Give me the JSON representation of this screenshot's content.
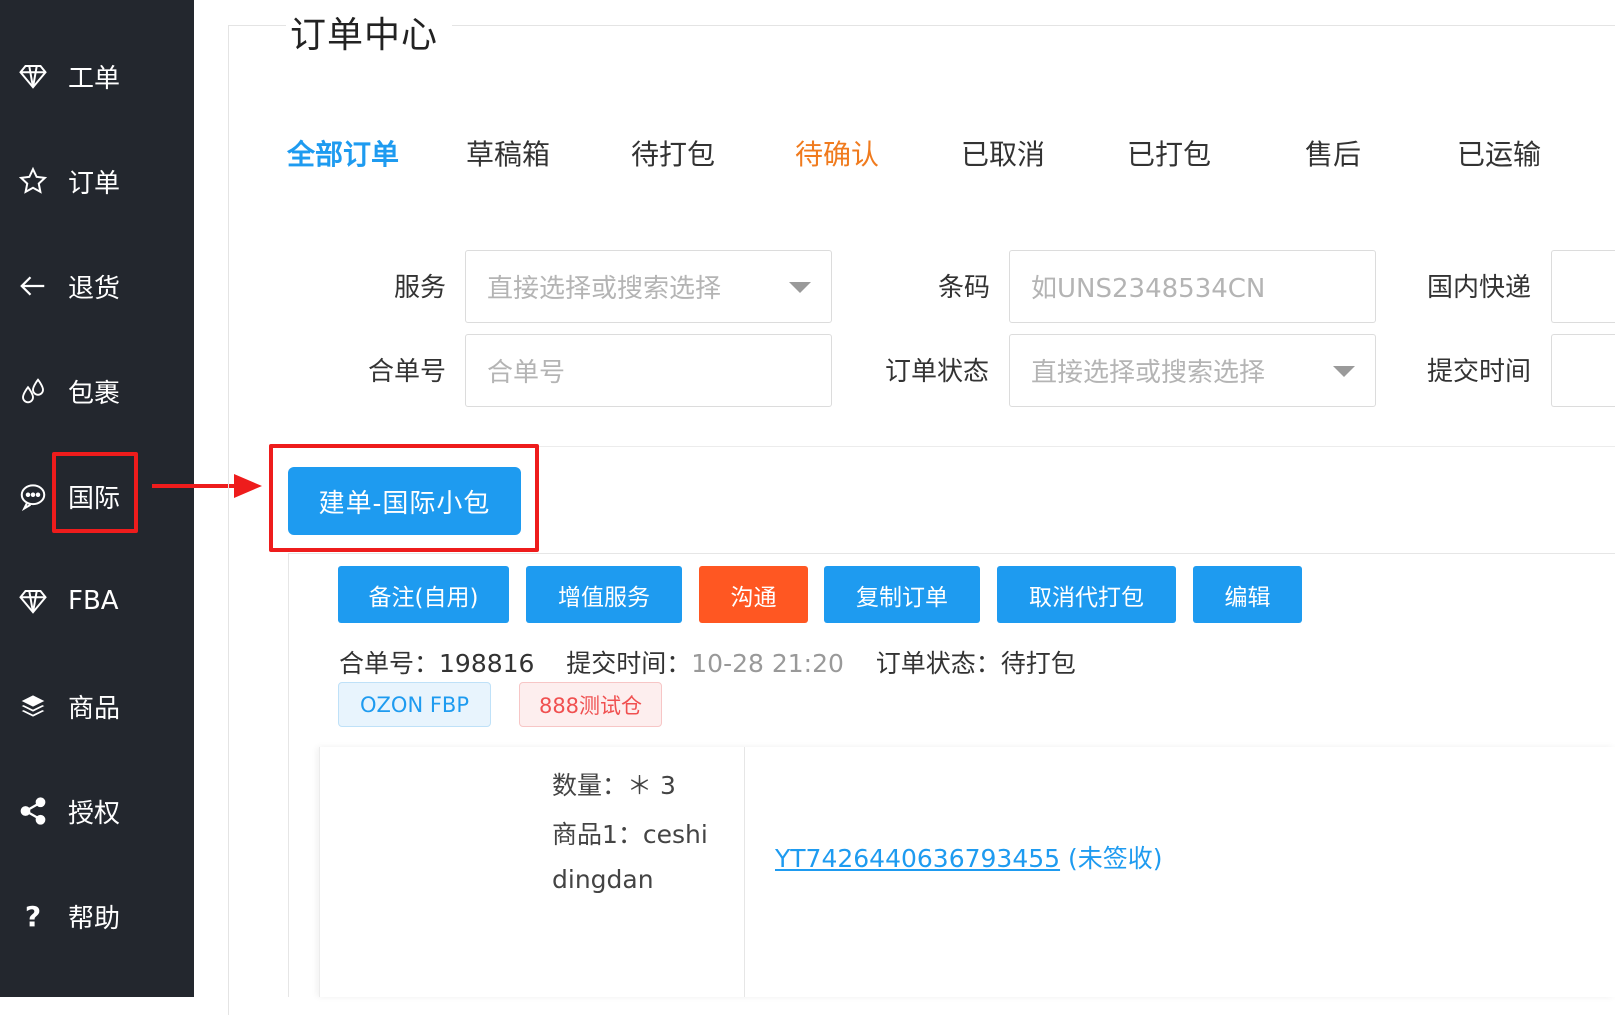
{
  "sidebar": {
    "items": [
      {
        "label": "工单",
        "icon": "diamond-icon"
      },
      {
        "label": "订单",
        "icon": "star-icon"
      },
      {
        "label": "退货",
        "icon": "arrow-left-icon"
      },
      {
        "label": "包裹",
        "icon": "drops-icon"
      },
      {
        "label": "国际",
        "icon": "chat-bubble-icon"
      },
      {
        "label": "FBA",
        "icon": "diamond-icon"
      },
      {
        "label": "商品",
        "icon": "layers-icon"
      },
      {
        "label": "授权",
        "icon": "share-icon"
      },
      {
        "label": "帮助",
        "icon": "question-icon"
      }
    ]
  },
  "page": {
    "title": "订单中心"
  },
  "tabs": [
    {
      "label": "全部订单",
      "state": "active"
    },
    {
      "label": "草稿箱"
    },
    {
      "label": "待打包"
    },
    {
      "label": "待确认",
      "state": "warn"
    },
    {
      "label": "已取消"
    },
    {
      "label": "已打包"
    },
    {
      "label": "售后"
    },
    {
      "label": "已运输"
    }
  ],
  "filters": {
    "service": {
      "label": "服务",
      "placeholder": "直接选择或搜索选择"
    },
    "barcode": {
      "label": "条码",
      "placeholder": "如UNS2348534CN"
    },
    "domestic_express": {
      "label": "国内快递"
    },
    "merge_no": {
      "label": "合单号",
      "placeholder": "合单号"
    },
    "order_status": {
      "label": "订单状态",
      "placeholder": "直接选择或搜索选择"
    },
    "submit_time": {
      "label": "提交时间"
    }
  },
  "create_button": {
    "label": "建单-国际小包"
  },
  "actions": [
    {
      "label": "备注(自用)",
      "color": "#1e9bf0"
    },
    {
      "label": "增值服务",
      "color": "#1e9bf0"
    },
    {
      "label": "沟通",
      "color": "#ff5722"
    },
    {
      "label": "复制订单",
      "color": "#1e9bf0"
    },
    {
      "label": "取消代打包",
      "color": "#1e9bf0"
    },
    {
      "label": "编辑",
      "color": "#1e9bf0"
    }
  ],
  "order": {
    "merge_label": "合单号：",
    "merge_no": "198816",
    "submit_label": "提交时间：",
    "submit_time": "10-28 21:20",
    "status_label": "订单状态：",
    "status": "待打包",
    "tags": [
      "OZON FBP",
      "888测试仓"
    ],
    "quantity": "数量：＊ 3",
    "product_line1": "商品1：ceshi",
    "product_line2": "dingdan",
    "tracking_no": "YT7426440636793455",
    "tracking_status": "(未签收)"
  },
  "colors": {
    "sidebar_bg": "#23272e",
    "primary": "#1e9bf0",
    "warn": "#f07b1e",
    "danger": "#ff5722",
    "highlight": "#ee1c1c"
  }
}
